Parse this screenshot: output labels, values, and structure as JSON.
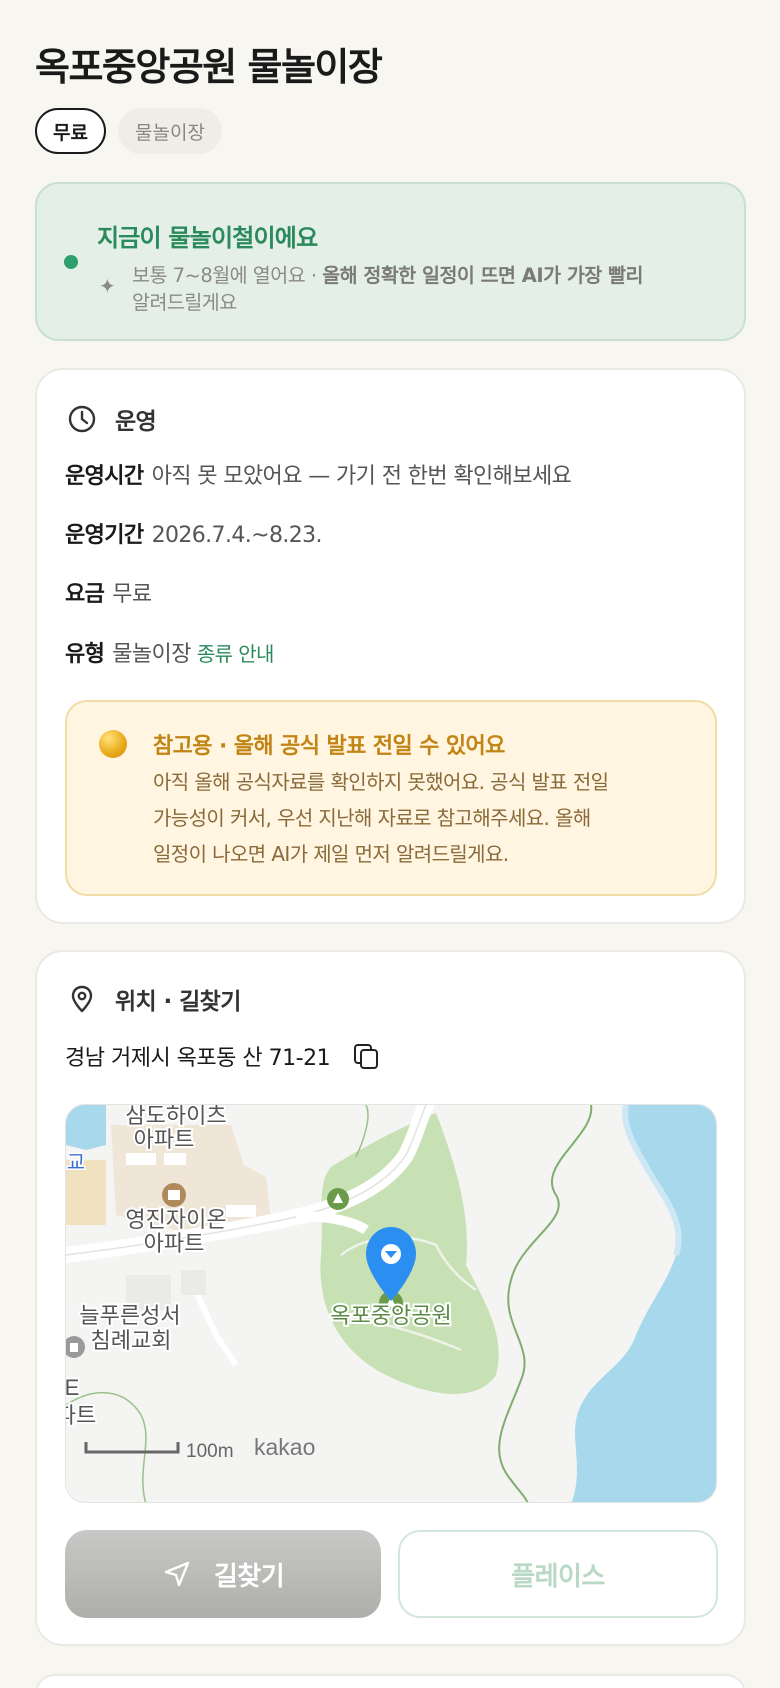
{
  "header": {
    "title": "옥포중앙공원 물놀이장",
    "tags": [
      "무료",
      "물놀이장"
    ]
  },
  "season": {
    "title": "지금이 물놀이철이에요",
    "desc_normal": "보통 7~8월에 열어요 · ",
    "desc_bold": "올해 정확한 일정이 뜨면 AI가 가장 빨리",
    "desc_tail": "알려드릴게요"
  },
  "operation": {
    "section_title": "운영",
    "hours_key": "운영시간",
    "hours_value": "아직 못 모았어요 — 가기 전 한번 확인해보세요",
    "period_key": "운영기간",
    "period_value": "2026.7.4.~8.23.",
    "fee_key": "요금",
    "fee_value": "무료",
    "type_key": "유형",
    "type_value": "물놀이장",
    "type_link": "종류 안내",
    "notice_title": "참고용 · 올해 공식 발표 전일 수 있어요",
    "notice_line1": "아직 올해 공식자료를 확인하지 못했어요. 공식 발표 전일",
    "notice_line2": "가능성이 커서, 우선 지난해 자료로 참고해주세요. 올해",
    "notice_line3": "일정이 나오면 AI가 제일 먼저 알려드릴게요."
  },
  "location": {
    "section_title": "위치 · 길찾기",
    "address": "경남 거제시 옥포동 산 71-21",
    "map": {
      "labels": {
        "samdo_1": "삼도하이츠",
        "samdo_2": "아파트",
        "school": "교",
        "yeongjin_1": "영진자이온",
        "yeongjin_2": "아파트",
        "church_1": "늘푸른성서",
        "church_2": "침례교회",
        "apt_partial_1": "E",
        "apt_partial_2": "파트",
        "park": "옥포중앙공원"
      },
      "scale": "100m",
      "brand": "kakao"
    },
    "route_button": "길찾기",
    "place_button": "플레이스"
  },
  "colors": {
    "accent_green": "#2a8a5b",
    "pin_blue": "#2b8ff2",
    "notice_orange": "#c28415"
  }
}
